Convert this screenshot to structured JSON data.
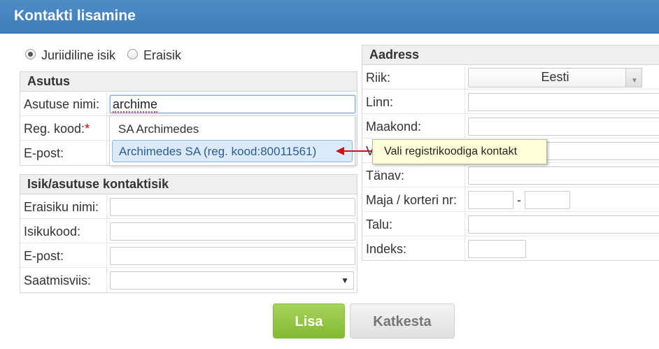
{
  "window": {
    "title": "Kontakti lisamine"
  },
  "entity_type": {
    "options": [
      "Juriidiline isik",
      "Eraisik"
    ],
    "selected": "Juriidiline isik"
  },
  "asutus": {
    "heading": "Asutus",
    "name_label": "Asutuse nimi:",
    "name_value": "archime",
    "regkood_label": "Reg. kood:",
    "regkood_required": "*",
    "epost_label": "E-post:"
  },
  "autocomplete": {
    "items": [
      "SA Archimedes",
      "Archimedes SA (reg. kood:80011561)"
    ],
    "highlighted": 1
  },
  "tooltip": {
    "text": "Vali registrikoodiga kontakt"
  },
  "kontaktisik": {
    "heading": "Isik/asutuse kontaktisik",
    "name_label": "Eraisiku nimi:",
    "isikukood_label": "Isikukood:",
    "epost_label": "E-post:",
    "saatmisviis_label": "Saatmisviis:",
    "saatmisviis_arrow": "▼"
  },
  "aadress": {
    "heading": "Aadress",
    "riik_label": "Riik:",
    "riik_value": "Eesti",
    "linn_label": "Linn:",
    "maakond_label": "Maakond:",
    "hidden_row_label_partial": "V",
    "tanav_label": "Tänav:",
    "maja_label": "Maja / korteri nr:",
    "maja_separator": "-",
    "talu_label": "Talu:",
    "indeks_label": "Indeks:"
  },
  "buttons": {
    "add": "Lisa",
    "cancel": "Katkesta"
  },
  "colors": {
    "titlebar": "#4a87c2",
    "add_button": "#94c545",
    "tooltip_bg": "#ffffd8",
    "highlight": "#dbe9f8"
  }
}
